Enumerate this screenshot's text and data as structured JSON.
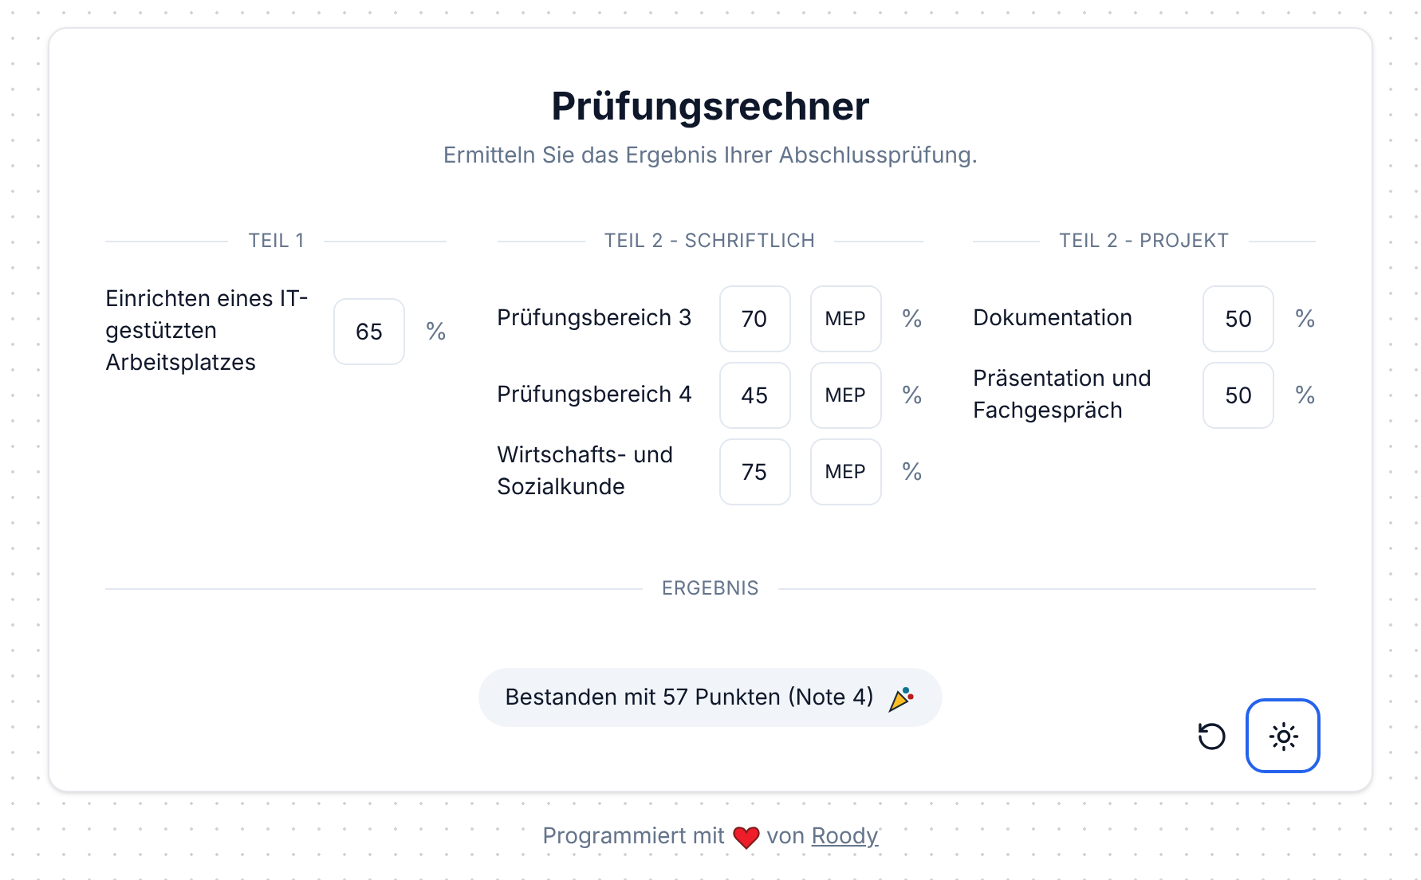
{
  "title": "Prüfungsrechner",
  "subtitle": "Ermitteln Sie das Ergebnis Ihrer Abschlussprüfung.",
  "sections": [
    {
      "heading": "TEIL 1",
      "fields": [
        {
          "label": "Einrichten eines IT-gestützten Arbeitsplatzes",
          "value": "65",
          "unit": "%"
        }
      ]
    },
    {
      "heading": "TEIL 2 - SCHRIFTLICH",
      "fields": [
        {
          "label": "Prüfungsbereich 3",
          "value": "70",
          "extra_button": "MEP",
          "unit": "%"
        },
        {
          "label": "Prüfungsbereich 4",
          "value": "45",
          "extra_button": "MEP",
          "unit": "%"
        },
        {
          "label": "Wirtschafts- und Sozialkunde",
          "value": "75",
          "extra_button": "MEP",
          "unit": "%"
        }
      ]
    },
    {
      "heading": "TEIL 2 - PROJEKT",
      "fields": [
        {
          "label": "Dokumentation",
          "value": "50",
          "unit": "%"
        },
        {
          "label": "Präsentation und Fachgespräch",
          "value": "50",
          "unit": "%"
        }
      ]
    }
  ],
  "result": {
    "heading": "ERGEBNIS",
    "text": "Bestanden mit 57 Punkten (Note 4)"
  },
  "theme_button": {
    "focused": true
  },
  "footer": {
    "prefix": "Programmiert mit",
    "middle": "von",
    "link": "Roody"
  }
}
